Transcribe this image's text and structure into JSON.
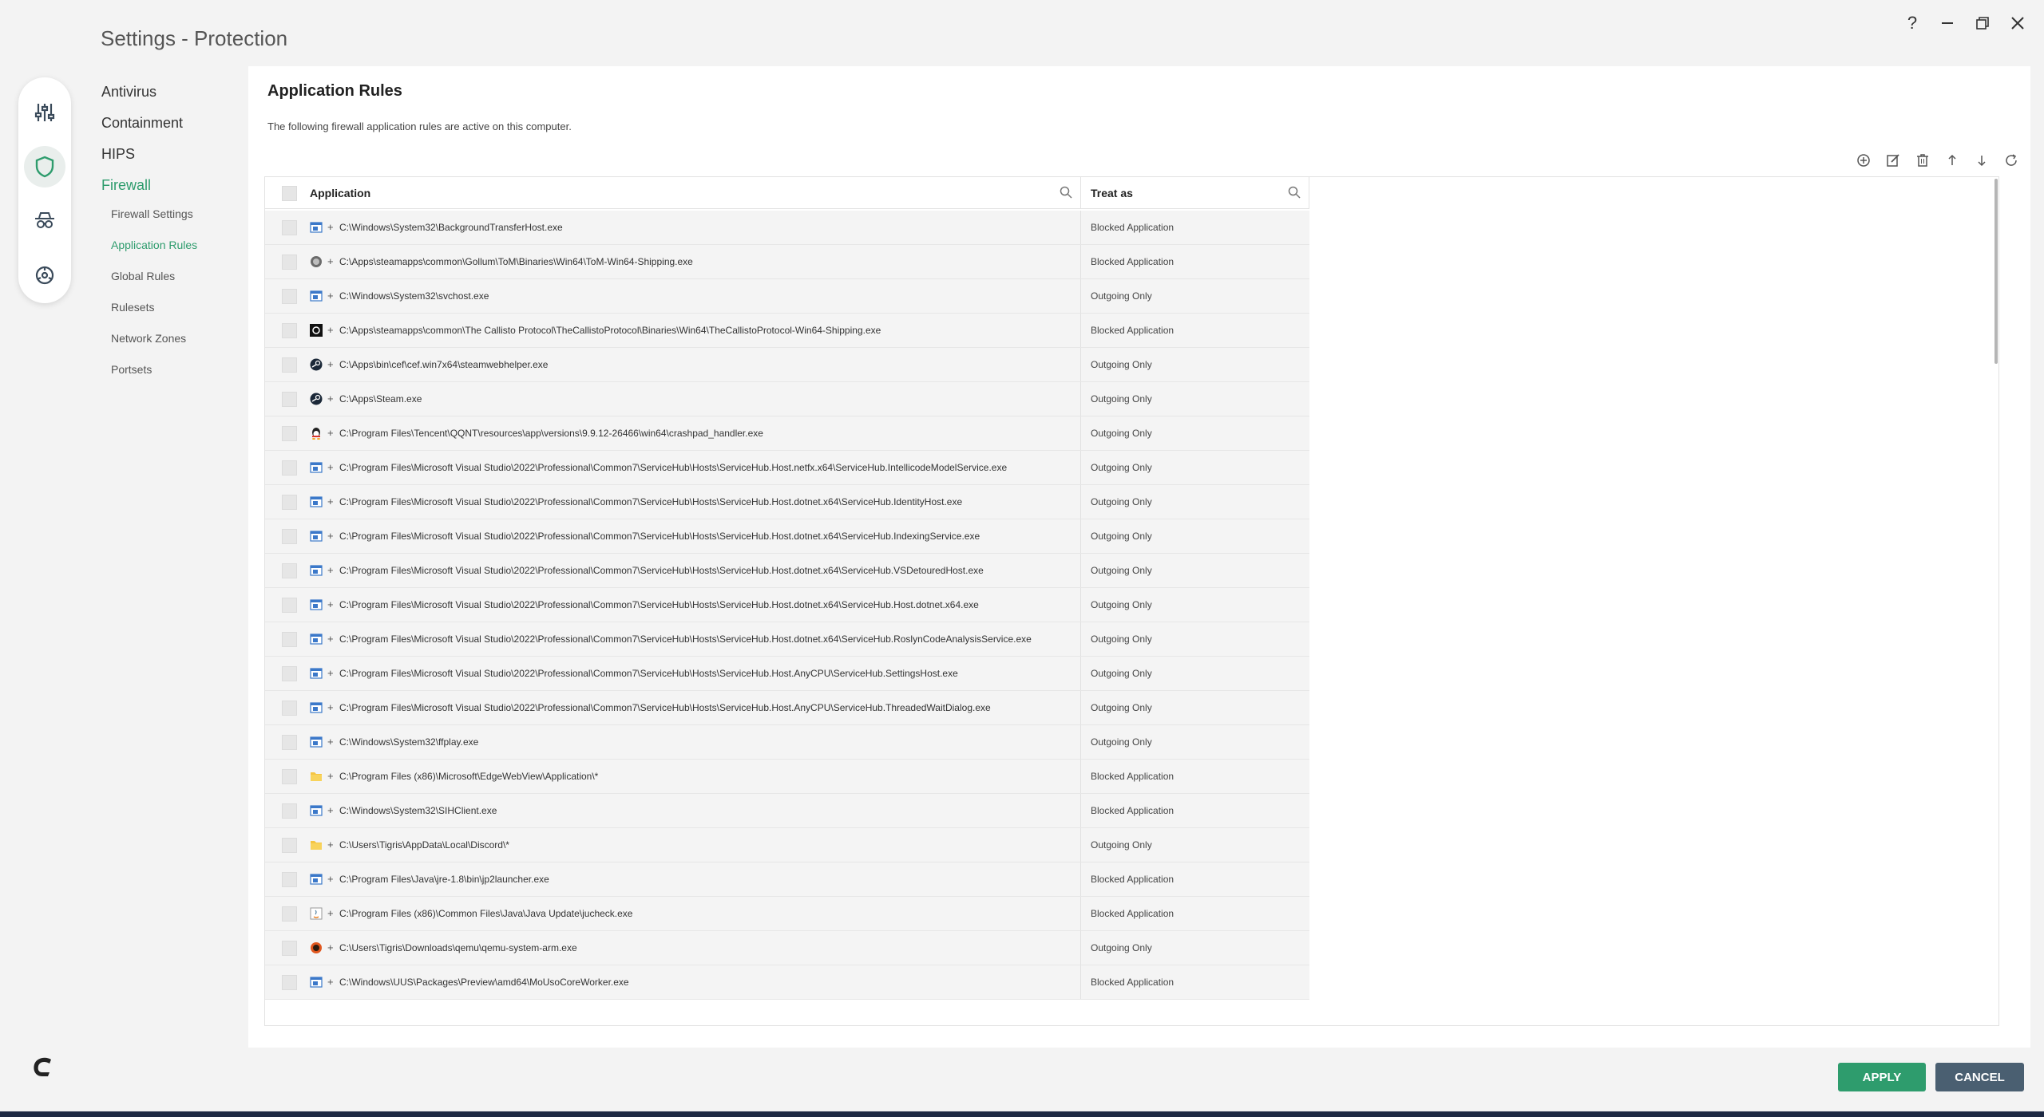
{
  "window": {
    "title": "Settings - Protection",
    "controls": {
      "help": "?",
      "minimize": "—",
      "restore": "❐",
      "close": "✕"
    }
  },
  "rail": [
    "sliders-icon",
    "shield-icon",
    "spy-icon",
    "biohazard-icon"
  ],
  "nav": {
    "items": [
      "Antivirus",
      "Containment",
      "HIPS",
      "Firewall"
    ],
    "active": "Firewall",
    "subitems": [
      "Firewall Settings",
      "Application Rules",
      "Global Rules",
      "Rulesets",
      "Network Zones",
      "Portsets"
    ],
    "active_sub": "Application Rules"
  },
  "panel": {
    "title": "Application Rules",
    "description": "The following firewall application rules are active on this computer."
  },
  "toolbar": [
    "add-icon",
    "edit-icon",
    "delete-icon",
    "move-up-icon",
    "move-down-icon",
    "refresh-icon"
  ],
  "table": {
    "columns": {
      "application": "Application",
      "treat_as": "Treat as"
    },
    "rows": [
      {
        "icon": "system",
        "path": "C:\\Windows\\System32\\BackgroundTransferHost.exe",
        "treat": "Blocked Application"
      },
      {
        "icon": "gollum",
        "path": "C:\\Apps\\steamapps\\common\\Gollum\\ToM\\Binaries\\Win64\\ToM-Win64-Shipping.exe",
        "treat": "Blocked Application"
      },
      {
        "icon": "system",
        "path": "C:\\Windows\\System32\\svchost.exe",
        "treat": "Outgoing Only"
      },
      {
        "icon": "callisto",
        "path": "C:\\Apps\\steamapps\\common\\The Callisto Protocol\\TheCallistoProtocol\\Binaries\\Win64\\TheCallistoProtocol-Win64-Shipping.exe",
        "treat": "Blocked Application"
      },
      {
        "icon": "steam",
        "path": "C:\\Apps\\bin\\cef\\cef.win7x64\\steamwebhelper.exe",
        "treat": "Outgoing Only"
      },
      {
        "icon": "steam",
        "path": "C:\\Apps\\Steam.exe",
        "treat": "Outgoing Only"
      },
      {
        "icon": "qq",
        "path": "C:\\Program Files\\Tencent\\QQNT\\resources\\app\\versions\\9.9.12-26466\\win64\\crashpad_handler.exe",
        "treat": "Outgoing Only"
      },
      {
        "icon": "system",
        "path": "C:\\Program Files\\Microsoft Visual Studio\\2022\\Professional\\Common7\\ServiceHub\\Hosts\\ServiceHub.Host.netfx.x64\\ServiceHub.IntellicodeModelService.exe",
        "treat": "Outgoing Only"
      },
      {
        "icon": "system",
        "path": "C:\\Program Files\\Microsoft Visual Studio\\2022\\Professional\\Common7\\ServiceHub\\Hosts\\ServiceHub.Host.dotnet.x64\\ServiceHub.IdentityHost.exe",
        "treat": "Outgoing Only"
      },
      {
        "icon": "system",
        "path": "C:\\Program Files\\Microsoft Visual Studio\\2022\\Professional\\Common7\\ServiceHub\\Hosts\\ServiceHub.Host.dotnet.x64\\ServiceHub.IndexingService.exe",
        "treat": "Outgoing Only"
      },
      {
        "icon": "system",
        "path": "C:\\Program Files\\Microsoft Visual Studio\\2022\\Professional\\Common7\\ServiceHub\\Hosts\\ServiceHub.Host.dotnet.x64\\ServiceHub.VSDetouredHost.exe",
        "treat": "Outgoing Only"
      },
      {
        "icon": "system",
        "path": "C:\\Program Files\\Microsoft Visual Studio\\2022\\Professional\\Common7\\ServiceHub\\Hosts\\ServiceHub.Host.dotnet.x64\\ServiceHub.Host.dotnet.x64.exe",
        "treat": "Outgoing Only"
      },
      {
        "icon": "system",
        "path": "C:\\Program Files\\Microsoft Visual Studio\\2022\\Professional\\Common7\\ServiceHub\\Hosts\\ServiceHub.Host.dotnet.x64\\ServiceHub.RoslynCodeAnalysisService.exe",
        "treat": "Outgoing Only"
      },
      {
        "icon": "system",
        "path": "C:\\Program Files\\Microsoft Visual Studio\\2022\\Professional\\Common7\\ServiceHub\\Hosts\\ServiceHub.Host.AnyCPU\\ServiceHub.SettingsHost.exe",
        "treat": "Outgoing Only"
      },
      {
        "icon": "system",
        "path": "C:\\Program Files\\Microsoft Visual Studio\\2022\\Professional\\Common7\\ServiceHub\\Hosts\\ServiceHub.Host.AnyCPU\\ServiceHub.ThreadedWaitDialog.exe",
        "treat": "Outgoing Only"
      },
      {
        "icon": "system",
        "path": "C:\\Windows\\System32\\ffplay.exe",
        "treat": "Outgoing Only"
      },
      {
        "icon": "folder",
        "path": "C:\\Program Files (x86)\\Microsoft\\EdgeWebView\\Application\\*",
        "treat": "Blocked Application"
      },
      {
        "icon": "system",
        "path": "C:\\Windows\\System32\\SIHClient.exe",
        "treat": "Blocked Application"
      },
      {
        "icon": "folder",
        "path": "C:\\Users\\Tigris\\AppData\\Local\\Discord\\*",
        "treat": "Outgoing Only"
      },
      {
        "icon": "system",
        "path": "C:\\Program Files\\Java\\jre-1.8\\bin\\jp2launcher.exe",
        "treat": "Blocked Application"
      },
      {
        "icon": "java",
        "path": "C:\\Program Files (x86)\\Common Files\\Java\\Java Update\\jucheck.exe",
        "treat": "Blocked Application"
      },
      {
        "icon": "qemu",
        "path": "C:\\Users\\Tigris\\Downloads\\qemu\\qemu-system-arm.exe",
        "treat": "Outgoing Only"
      },
      {
        "icon": "system",
        "path": "C:\\Windows\\UUS\\Packages\\Preview\\amd64\\MoUsoCoreWorker.exe",
        "treat": "Blocked Application"
      }
    ]
  },
  "buttons": {
    "apply": "APPLY",
    "cancel": "CANCEL"
  },
  "colors": {
    "accent": "#2e9c6d",
    "cancel": "#4a5f71",
    "taskbar": "#1e2a44"
  }
}
